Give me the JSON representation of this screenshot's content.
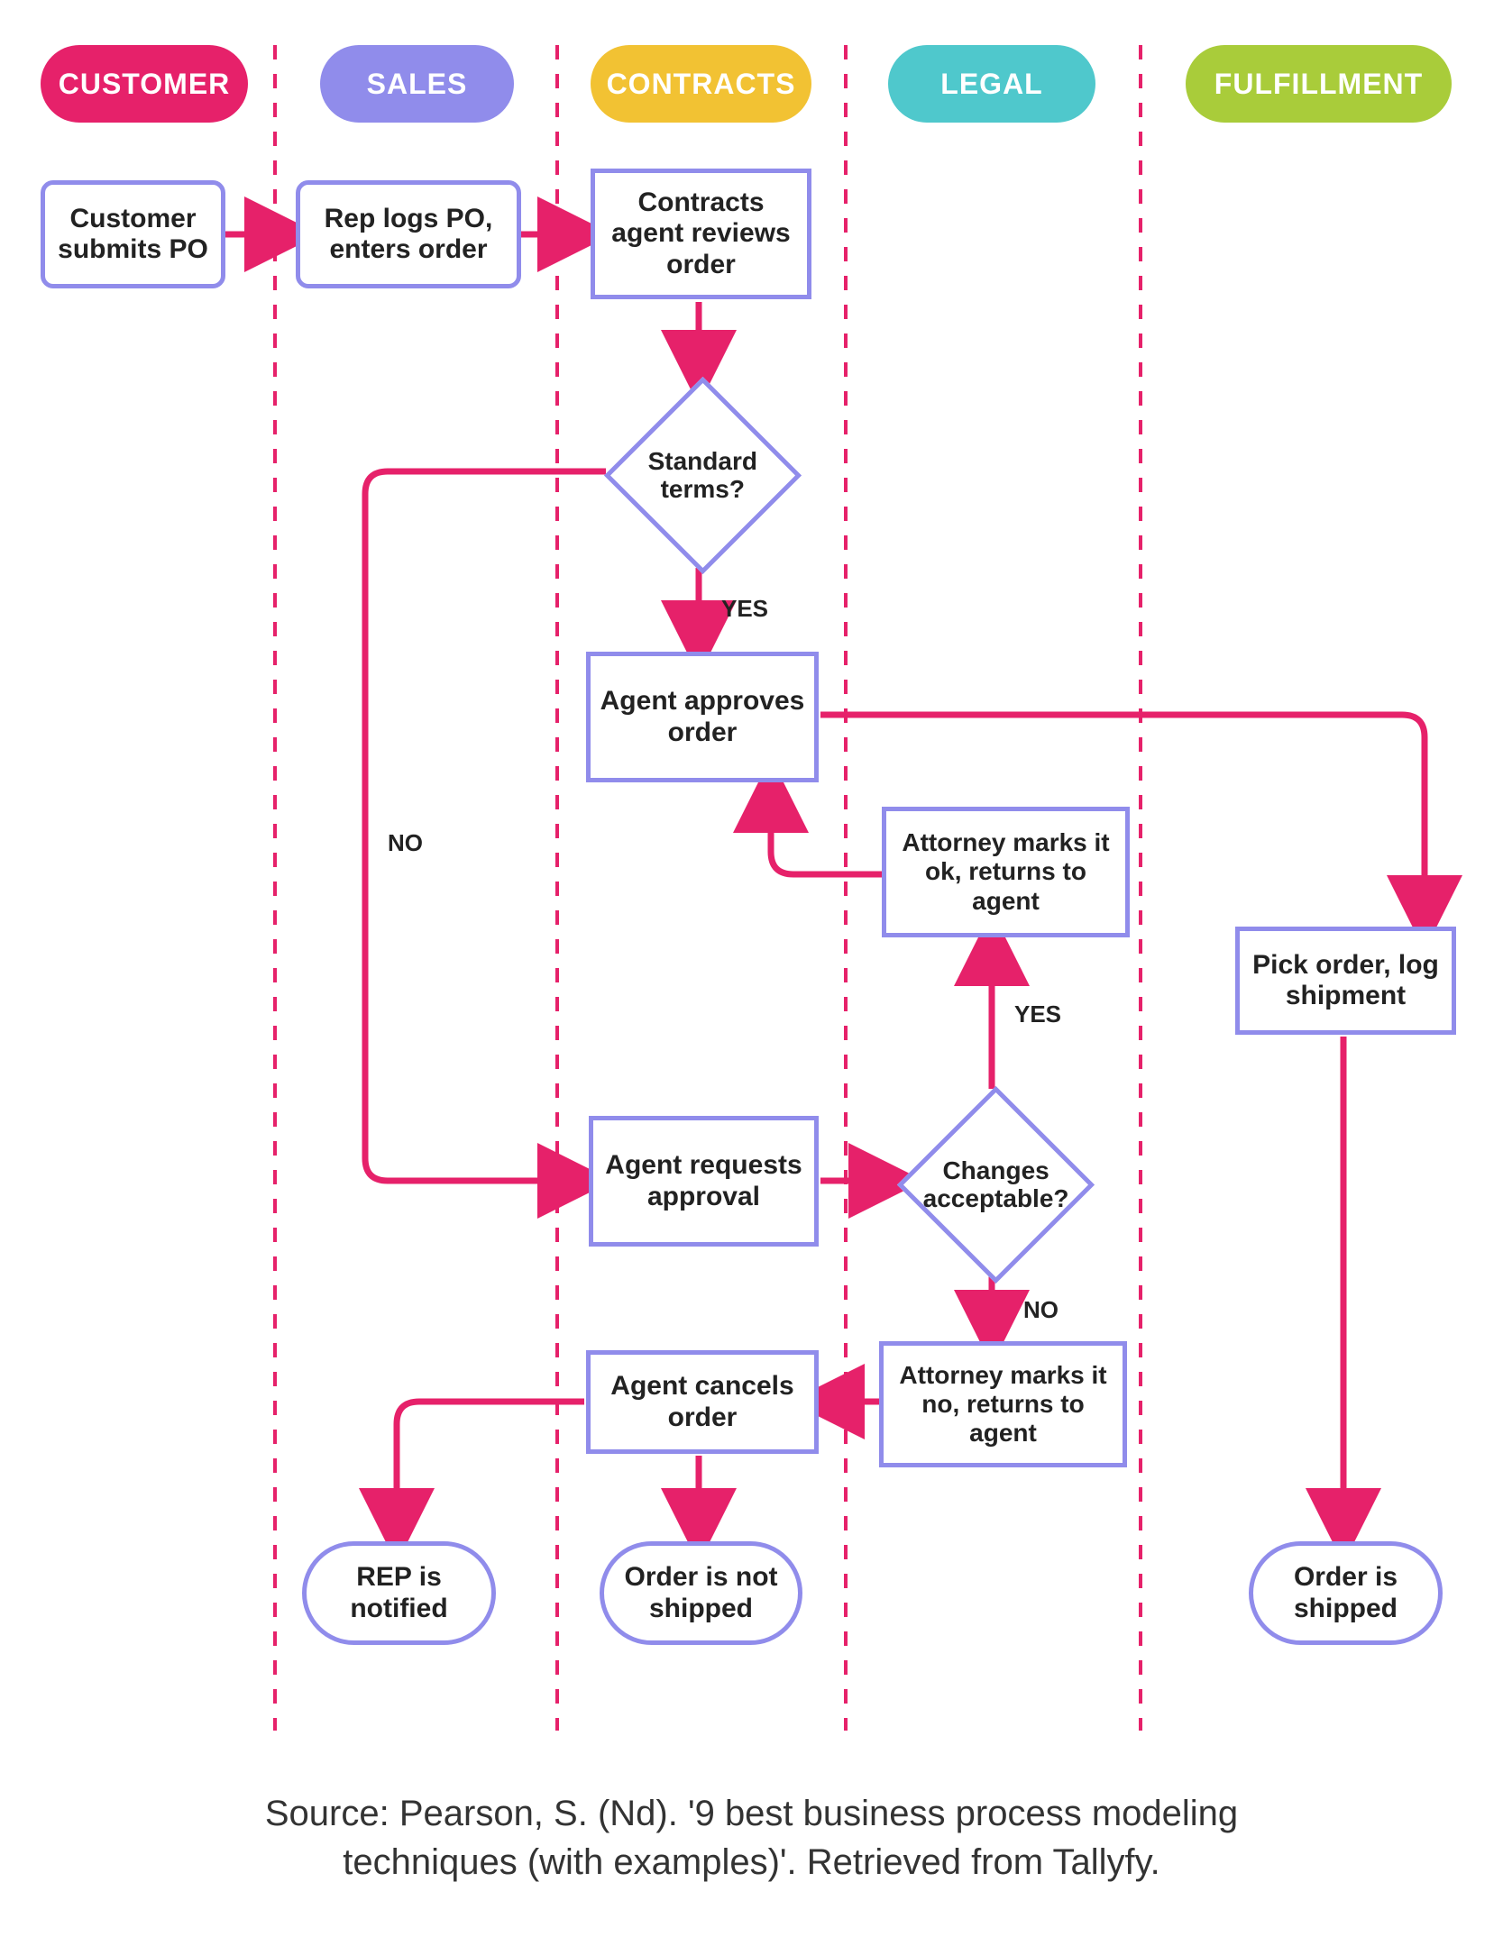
{
  "lanes": [
    {
      "label": "CUSTOMER",
      "color": "#E6216A"
    },
    {
      "label": "SALES",
      "color": "#908CEB"
    },
    {
      "label": "CONTRACTS",
      "color": "#F2C233"
    },
    {
      "label": "LEGAL",
      "color": "#4FC8CC"
    },
    {
      "label": "FULFILLMENT",
      "color": "#A9CC3A"
    }
  ],
  "nodes": {
    "customer_po": "Customer submits PO",
    "rep_logs": "Rep logs PO, enters order",
    "agent_reviews": "Contracts agent reviews order",
    "std_terms": "Standard terms?",
    "agent_approves": "Agent approves order",
    "att_ok": "Attorney marks it ok, returns to agent",
    "pick_order": "Pick order, log shipment",
    "agent_requests": "Agent requests approval",
    "changes_acc": "Changes acceptable?",
    "att_no": "Attorney marks it no, returns to agent",
    "agent_cancels": "Agent cancels order",
    "rep_notified": "REP is notified",
    "not_shipped": "Order is not shipped",
    "shipped": "Order is shipped"
  },
  "labels": {
    "yes": "YES",
    "no": "NO"
  },
  "caption": "Source: Pearson, S. (Nd). '9 best business process modeling techniques (with examples)'. Retrieved from Tallyfy.",
  "colors": {
    "arrow": "#E6216A",
    "node_border": "#908CEB",
    "divider": "#E6216A"
  }
}
